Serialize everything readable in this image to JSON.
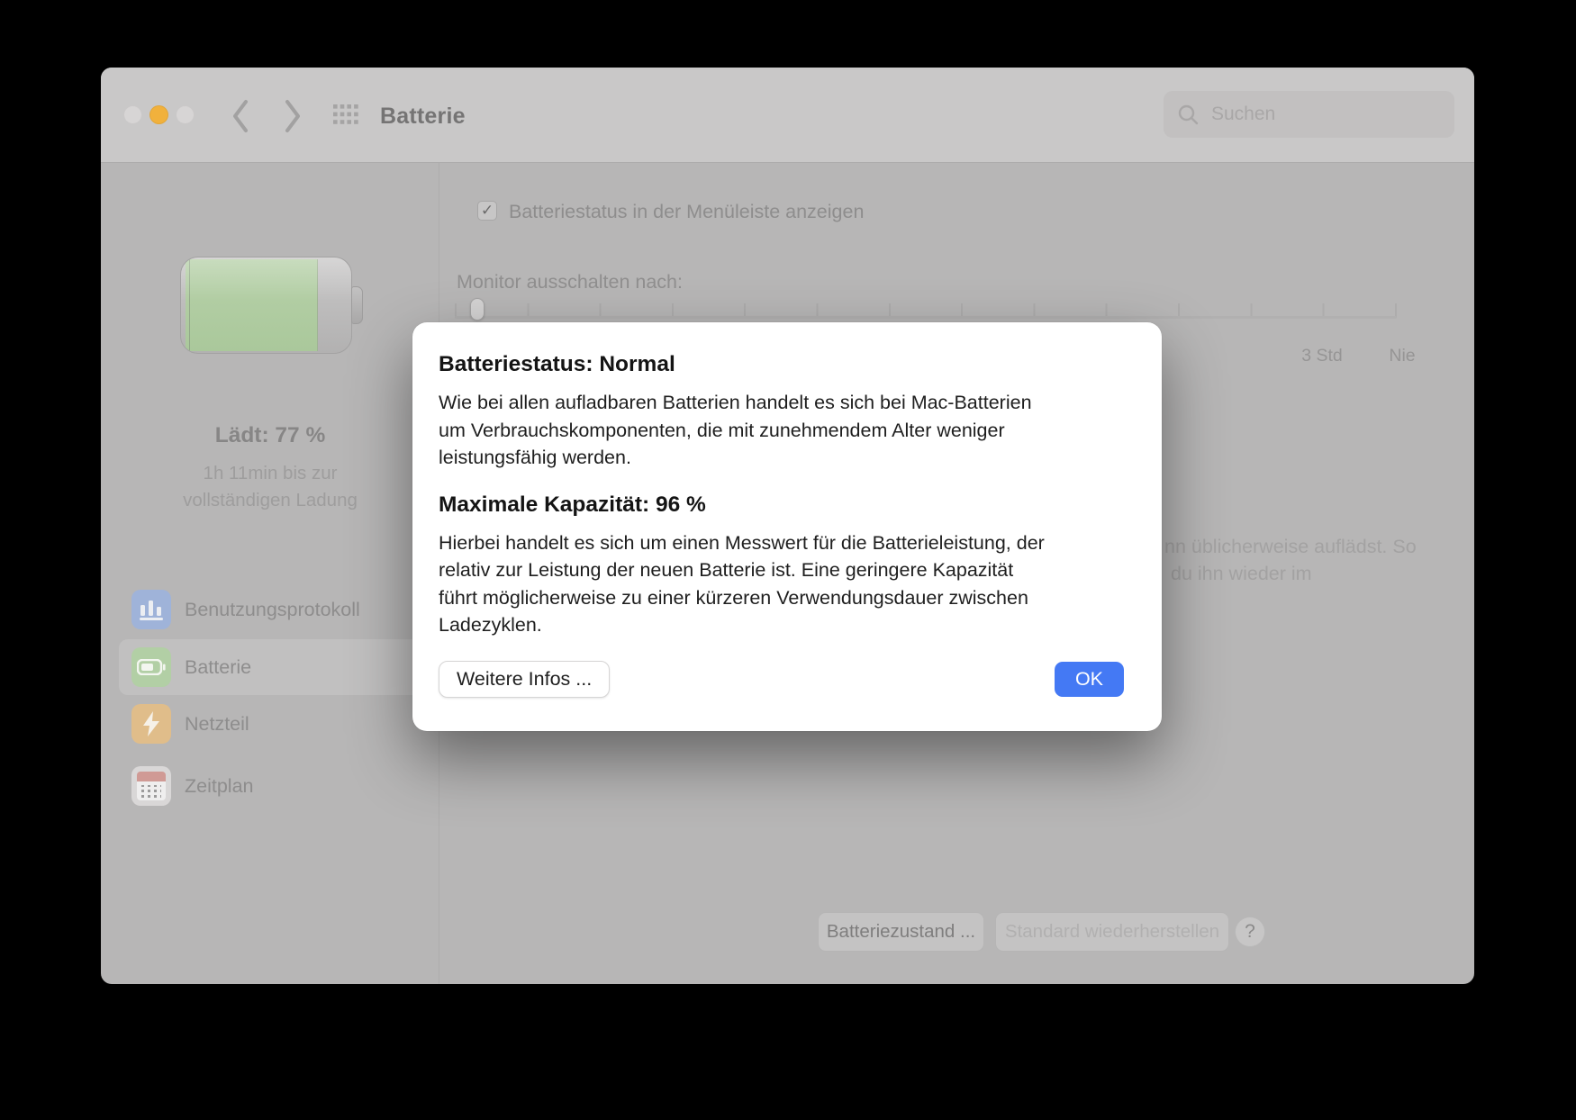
{
  "window": {
    "title": "Batterie"
  },
  "toolbar": {
    "search_placeholder": "Suchen"
  },
  "sidebar": {
    "battery_percent": 77,
    "charge_title": "Lädt: 77 %",
    "charge_subtitle": "1h 11min bis zur\nvollständigen Ladung",
    "items": [
      {
        "label": "Benutzungsprotokoll",
        "icon": "bar-chart-icon"
      },
      {
        "label": "Batterie",
        "icon": "battery-icon",
        "selected": true
      },
      {
        "label": "Netzteil",
        "icon": "bolt-icon"
      },
      {
        "label": "Zeitplan",
        "icon": "calendar-icon"
      }
    ]
  },
  "content": {
    "checkmark": "✓",
    "checkbox_checked": true,
    "menubar_checkbox_label": "Batteriestatus in der Menüleiste anzeigen",
    "display_off_label": "Monitor ausschalten nach:",
    "slider_labels": {
      "three_hours": "3 Std",
      "never": "Nie"
    },
    "occluded_text_line1": "nn üblicherweise auflädst. So",
    "occluded_text_line2": "du ihn wieder im",
    "footer": {
      "battery_health_label": "Batteriezustand ...",
      "restore_defaults_label": "Standard wiederherstellen",
      "help_label": "?"
    }
  },
  "dialog": {
    "title": "Batteriestatus: Normal",
    "body1": "Wie bei allen aufladbaren Batterien handelt es sich bei Mac-Batterien\num Verbrauchskomponenten, die mit zunehmendem Alter weniger\nleistungsfähig werden.",
    "subtitle": "Maximale Kapazität: 96 %",
    "body2": "Hierbei handelt es sich um einen Messwert für die Batterieleistung, der\nrelativ zur Leistung der neuen Batterie ist. Eine geringere Kapazität\nführt möglicherweise zu einer kürzeren Verwendungsdauer zwischen\nLadezyklen.",
    "more_info_label": "Weitere Infos ...",
    "ok_label": "OK"
  },
  "colors": {
    "accent_blue": "#4479F4",
    "battery_green": "#b7d1a9",
    "traffic_yellow": "#f1b13c",
    "icon_blue": "#9fb3d9",
    "icon_green": "#b2cfa5",
    "icon_orange": "#e0bd8a",
    "icon_red": "#d09a95"
  }
}
